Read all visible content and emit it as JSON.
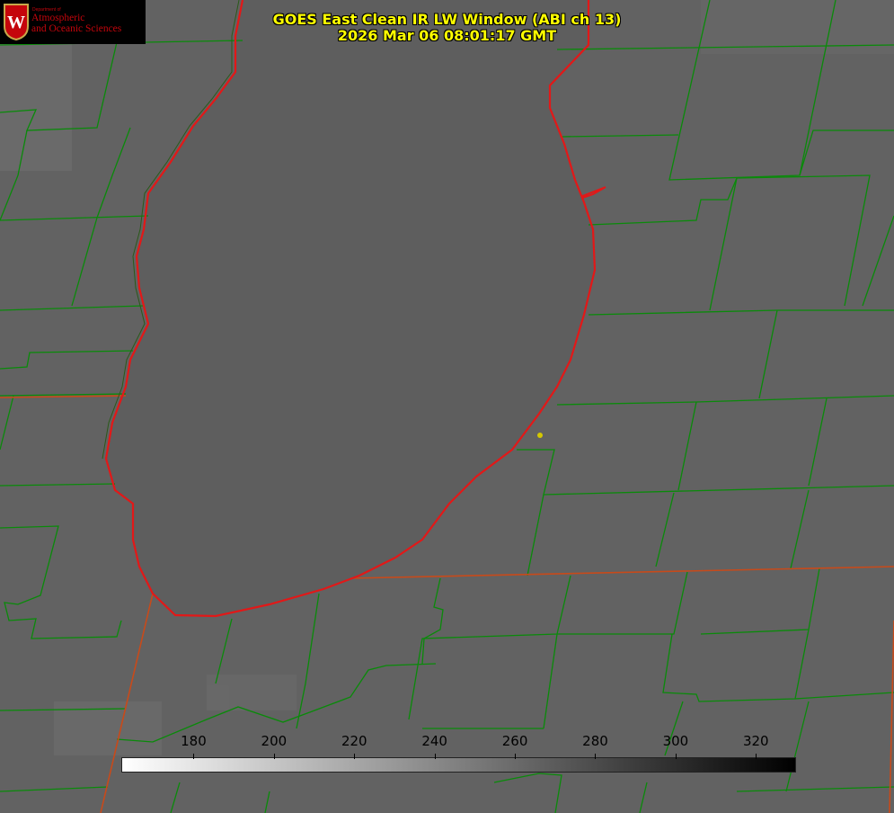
{
  "title_line1": "GOES East Clean IR LW Window (ABI ch 13)",
  "title_line2": "2026 Mar 06 08:01:17 GMT",
  "logo": {
    "department": "Department of",
    "name_line1": "Atmospheric",
    "name_line2": "and Oceanic Sciences",
    "seal_letter": "W"
  },
  "colorbar": {
    "min": 162,
    "max": 330,
    "ticks": [
      "180",
      "200",
      "220",
      "240",
      "260",
      "280",
      "300",
      "320"
    ],
    "start_color": "#ffffff",
    "end_color": "#000000"
  },
  "colors": {
    "background": "#606060",
    "lake": "#5d5d5d",
    "county_lines": "#0a8a0a",
    "coastline": "#e21818",
    "state_line": "#c84a1a",
    "title": "#ffff00",
    "marker": "#d4c800"
  }
}
